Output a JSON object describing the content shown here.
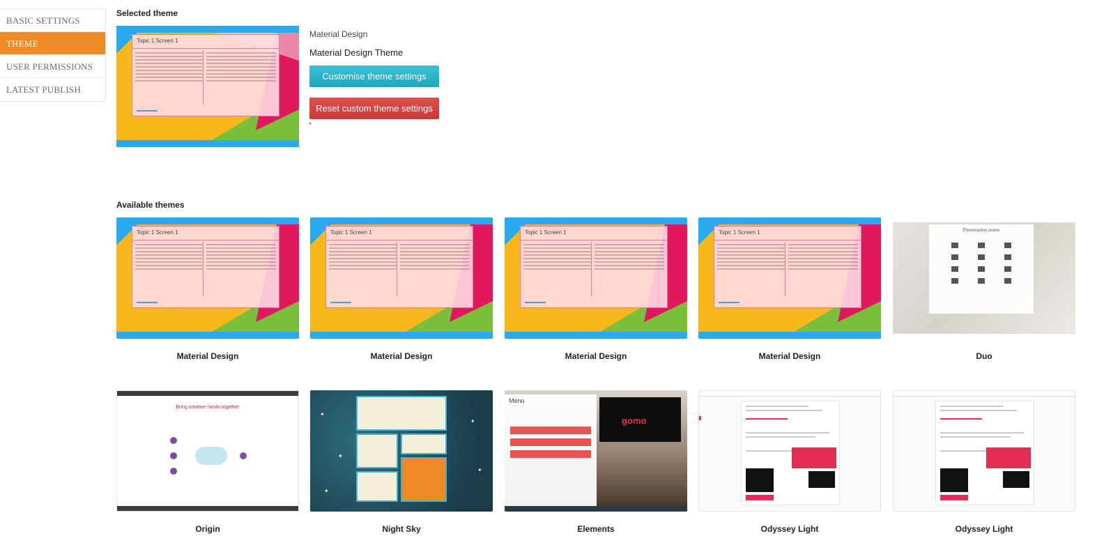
{
  "sidebar": {
    "items": [
      {
        "label": "BASIC SETTINGS",
        "active": false
      },
      {
        "label": "THEME",
        "active": true
      },
      {
        "label": "USER PERMISSIONS",
        "active": false
      },
      {
        "label": "LATEST PUBLISH",
        "active": false
      }
    ]
  },
  "selected": {
    "heading": "Selected theme",
    "theme_name": "Material Design",
    "theme_full_name": "Material Design Theme",
    "customise_label": "Customise theme settings",
    "reset_label": "Reset custom theme settings",
    "thumb_title": "Topic 1 Screen 1"
  },
  "available": {
    "heading": "Available themes",
    "themes": [
      {
        "name": "Material Design",
        "thumb_title": "Topic 1 Screen 1"
      },
      {
        "name": "Material Design",
        "thumb_title": "Topic 1 Screen 1"
      },
      {
        "name": "Material Design",
        "thumb_title": "Topic 1 Screen 1"
      },
      {
        "name": "Material Design",
        "thumb_title": "Topic 1 Screen 1"
      },
      {
        "name": "Duo",
        "thumb_title": "Presentation assets"
      },
      {
        "name": "Origin",
        "thumb_title": "Bring creative minds together"
      },
      {
        "name": "Night Sky",
        "thumb_title": ""
      },
      {
        "name": "Elements",
        "thumb_title": "Menu"
      },
      {
        "name": "Odyssey Light",
        "thumb_title": ""
      },
      {
        "name": "Odyssey Light",
        "thumb_title": ""
      }
    ]
  },
  "colors": {
    "accent": "#f08a26",
    "customise_button": "#28b3c8",
    "reset_button": "#d9464a",
    "material_blue": "#29a9f0",
    "material_pink": "#e0185d",
    "material_yellow": "#f8b71b",
    "material_green": "#7bbf3a"
  }
}
